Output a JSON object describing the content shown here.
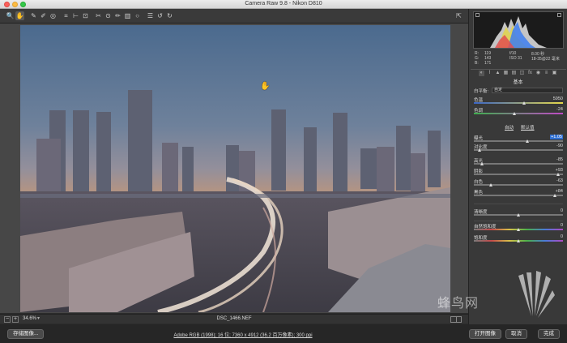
{
  "window": {
    "title": "Camera Raw 9.8  -  Nikon D810"
  },
  "toolbar": {
    "tools": [
      {
        "name": "zoom-tool",
        "glyph": "🔍"
      },
      {
        "name": "hand-tool",
        "glyph": "✋"
      },
      {
        "name": "white-balance-tool",
        "glyph": "✎"
      },
      {
        "name": "color-sampler-tool",
        "glyph": "✐"
      },
      {
        "name": "targeted-adjustment-tool",
        "glyph": "◎"
      },
      {
        "name": "crop-tool",
        "glyph": "⌗"
      },
      {
        "name": "straighten-tool",
        "glyph": "⊢"
      },
      {
        "name": "transform-tool",
        "glyph": "⊡"
      },
      {
        "name": "spot-removal-tool",
        "glyph": "✂"
      },
      {
        "name": "red-eye-tool",
        "glyph": "⊙"
      },
      {
        "name": "adjustment-brush-tool",
        "glyph": "✏"
      },
      {
        "name": "graduated-filter-tool",
        "glyph": "▥"
      },
      {
        "name": "radial-filter-tool",
        "glyph": "○"
      },
      {
        "name": "preferences",
        "glyph": "☰"
      },
      {
        "name": "rotate-ccw",
        "glyph": "↺"
      },
      {
        "name": "rotate-cw",
        "glyph": "↻"
      }
    ]
  },
  "status": {
    "zoom": "34.6%",
    "filename": "DSC_1466.NEF"
  },
  "bottom": {
    "save_label": "存储图像...",
    "workflow": "Adobe RGB (1998); 16 位; 7360 x 4912 (36.2 百万像素); 300 ppi",
    "open_label": "打开图像",
    "cancel_label": "取消",
    "done_label": "完成"
  },
  "camera_info": {
    "r_label": "R:",
    "r_value": "119",
    "g_label": "G:",
    "g_value": "143",
    "b_label": "B:",
    "b_value": "171",
    "aperture": "f/10",
    "shutter": "8.00 秒",
    "iso": "ISO 31",
    "lens": "18-35@22 毫米"
  },
  "basic_panel": {
    "section_title": "基本",
    "white_balance_label": "白平衡:",
    "white_balance_value": "自定",
    "temperature_label": "色温",
    "temperature_value": "5950",
    "tint_label": "色调",
    "tint_value": "-24",
    "auto_label": "自动",
    "default_label": "默认值",
    "exposure_label": "曝光",
    "exposure_value": "+1.05",
    "contrast_label": "对比度",
    "contrast_value": "-90",
    "highlights_label": "高光",
    "highlights_value": "-85",
    "shadows_label": "阴影",
    "shadows_value": "+93",
    "whites_label": "白色",
    "whites_value": "-63",
    "blacks_label": "黑色",
    "blacks_value": "+84",
    "clarity_label": "清晰度",
    "clarity_value": "0",
    "vibrance_label": "自然饱和度",
    "vibrance_value": "0",
    "saturation_label": "饱和度",
    "saturation_value": "0"
  },
  "slider_levels": {
    "temperature": 0.57,
    "tint": 0.45,
    "exposure": 0.6,
    "contrast": 0.05,
    "highlights": 0.08,
    "shadows": 0.96,
    "whites": 0.18,
    "blacks": 0.92,
    "clarity": 0.5,
    "vibrance": 0.5,
    "saturation": 0.5
  },
  "watermark": {
    "text": "蜂鸟网"
  }
}
